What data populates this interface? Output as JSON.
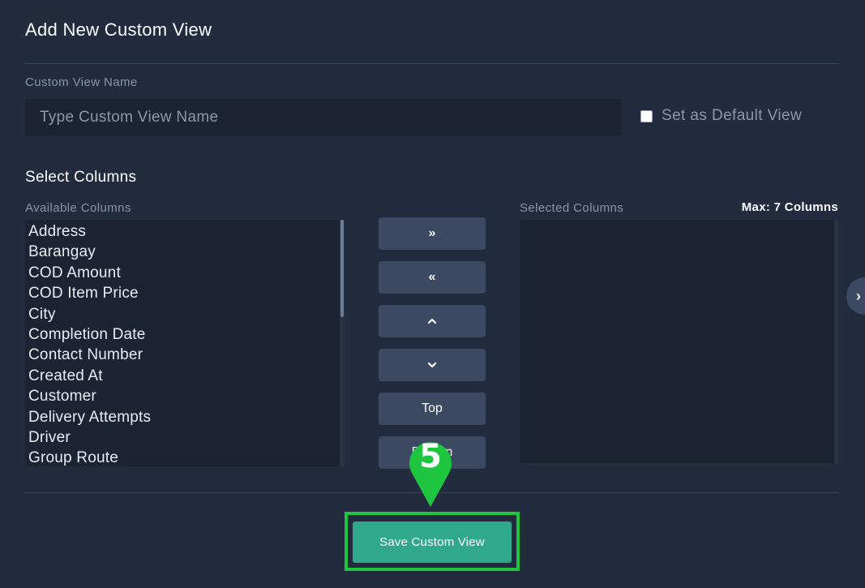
{
  "header": {
    "title": "Add New Custom View"
  },
  "name_field": {
    "label": "Custom View Name",
    "placeholder": "Type Custom View Name",
    "value": ""
  },
  "default_view": {
    "label": "Set as Default View",
    "checked": false
  },
  "columns": {
    "section_title": "Select Columns",
    "available_label": "Available Columns",
    "selected_label": "Selected Columns",
    "max_label": "Max: 7 Columns",
    "available": [
      "Address",
      "Barangay",
      "COD Amount",
      "COD Item Price",
      "City",
      "Completion Date",
      "Contact Number",
      "Created At",
      "Customer",
      "Delivery Attempts",
      "Driver",
      "Group Route"
    ],
    "selected": []
  },
  "controls": {
    "add_all": "»",
    "remove_all": "«",
    "move_up": "⌃",
    "move_down": "⌄",
    "top": "Top",
    "bottom": "Bottom"
  },
  "icons": {
    "side_toggle": "chevron-right-icon",
    "step_marker": "map-pin-icon"
  },
  "side_toggle": {
    "glyph": "›"
  },
  "annotation": {
    "step": "5",
    "color": "#1ec53f"
  },
  "footer": {
    "save_label": "Save Custom View"
  },
  "colors": {
    "background": "#222c3e",
    "panel": "#1c2434",
    "button": "#3b4a62",
    "accent": "#2fa98a"
  }
}
